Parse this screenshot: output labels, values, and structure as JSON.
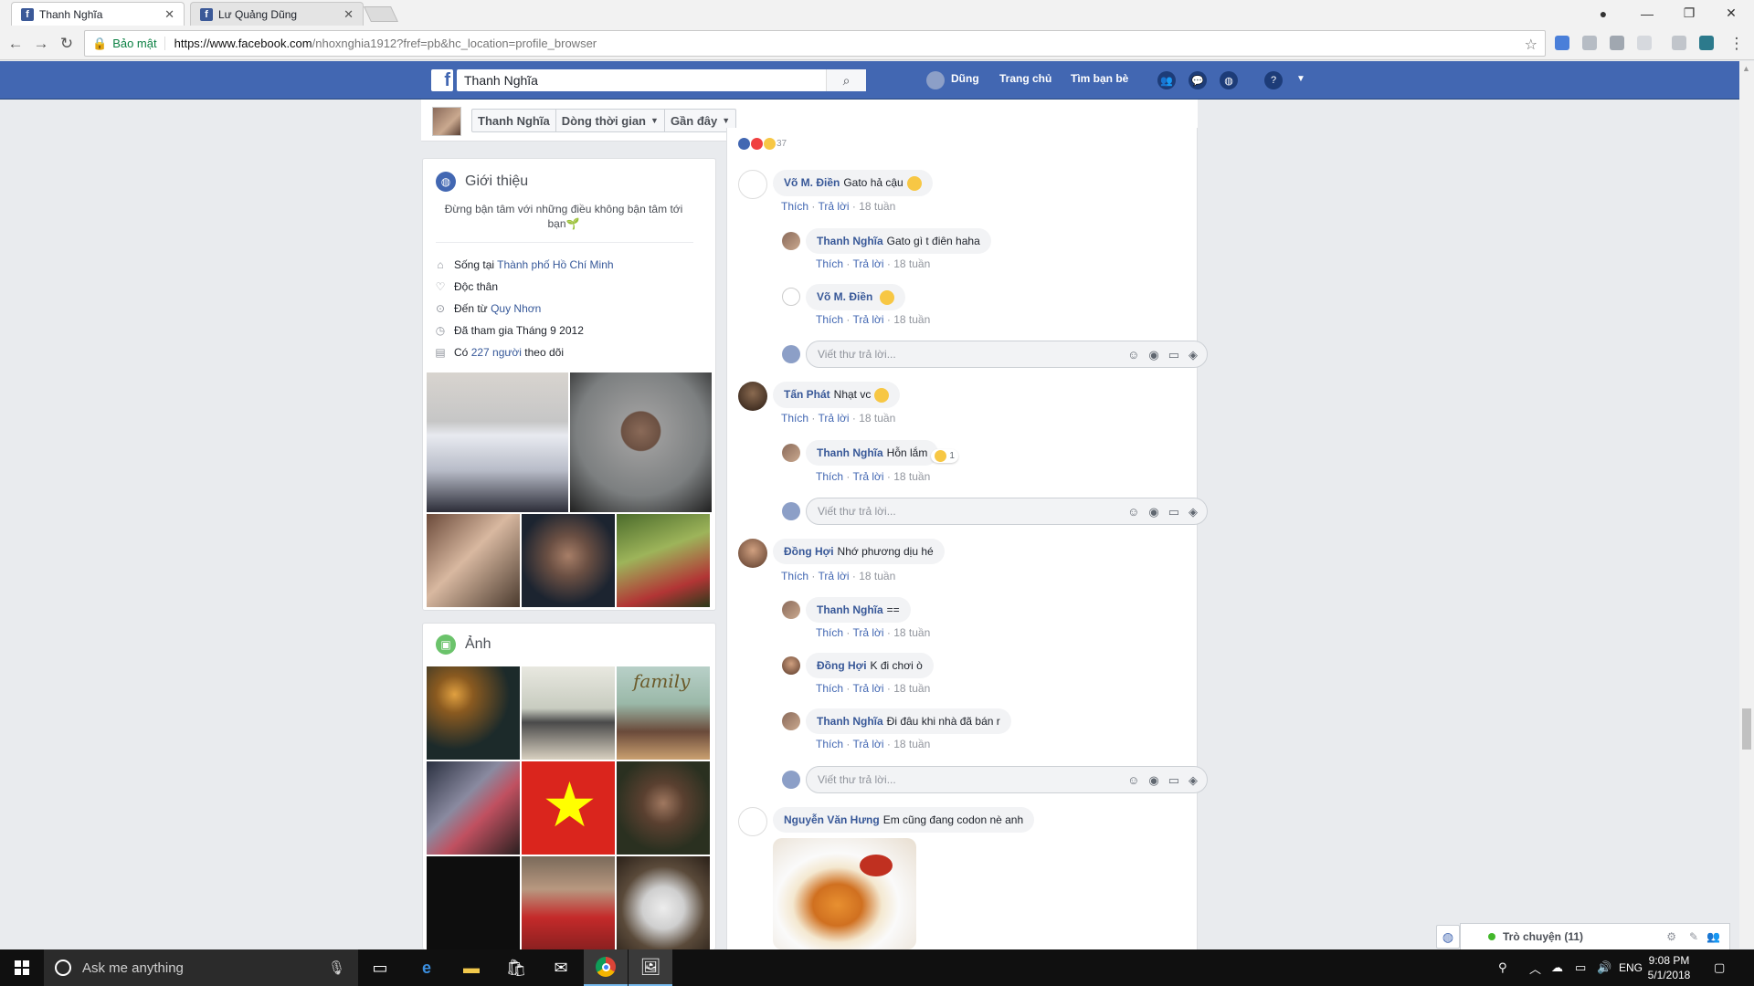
{
  "browser": {
    "tabs": [
      {
        "title": "Thanh Nghĩa",
        "active": true
      },
      {
        "title": "Lư Quảng Dũng",
        "active": false
      }
    ],
    "secure_label": "Bảo mật",
    "url_host": "https://www.facebook.com",
    "url_path": "/nhoxnghia1912?fref=pb&hc_location=profile_browser"
  },
  "facebook": {
    "logo_letter": "f",
    "search_value": "Thanh Nghĩa",
    "nav": {
      "user": "Dũng",
      "home": "Trang chủ",
      "find_friends": "Tìm bạn bè"
    },
    "timeline_bar": {
      "name": "Thanh Nghĩa",
      "timeline": "Dòng thời gian",
      "recent": "Gần đây"
    },
    "intro": {
      "title": "Giới thiệu",
      "bio_line1": "Đừng bận tâm với những điều không bận tâm tới",
      "bio_line2": "bạn",
      "lives_prefix": "Sống tại ",
      "lives_place": "Thành phố Hồ Chí Minh",
      "relationship": "Độc thân",
      "from_prefix": "Đến từ ",
      "from_place": "Quy Nhơn",
      "joined": "Đã tham gia Tháng 9 2012",
      "followers_prefix": "Có ",
      "followers_link": "227 người",
      "followers_suffix": " theo dõi"
    },
    "photos": {
      "title": "Ảnh",
      "family_caption": "family"
    },
    "reactions_count": "37",
    "comments": [
      {
        "name": "Võ M. Điền",
        "text": "Gato hả cậu",
        "time": "18 tuần"
      },
      {
        "name": "Thanh Nghĩa",
        "text": "Gato gì t điên haha",
        "time": "18 tuần"
      },
      {
        "name": "Võ M. Điền",
        "text": "",
        "time": "18 tuần"
      },
      {
        "name": "Tấn Phát",
        "text": "Nhạt vc",
        "time": "18 tuần"
      },
      {
        "name": "Thanh Nghĩa",
        "text": "Hỗn lắm",
        "time": "18 tuần",
        "reaction_count": "1"
      },
      {
        "name": "Đồng Hợi",
        "text": "Nhớ phương dịu hé",
        "time": "18 tuần"
      },
      {
        "name": "Thanh Nghĩa",
        "text": "==",
        "time": "18 tuần"
      },
      {
        "name": "Đồng Hợi",
        "text": "K đi chơi ò",
        "time": "18 tuần"
      },
      {
        "name": "Thanh Nghĩa",
        "text": "Đi đâu khi nhà đã bán r",
        "time": "18 tuần"
      },
      {
        "name": "Nguyễn Văn Hưng",
        "text": "Em cũng đang codon nè anh"
      }
    ],
    "like_label": "Thích",
    "reply_label": "Trả lời",
    "reply_placeholder": "Viết thư trả lời...",
    "chat_label": "Trò chuyện (11)"
  },
  "taskbar": {
    "search_placeholder": "Ask me anything",
    "lang": "ENG",
    "time": "9:08 PM",
    "date": "5/1/2018"
  },
  "colors": {
    "fb_blue": "#4267b2",
    "link": "#385898",
    "online": "#42b72a"
  }
}
